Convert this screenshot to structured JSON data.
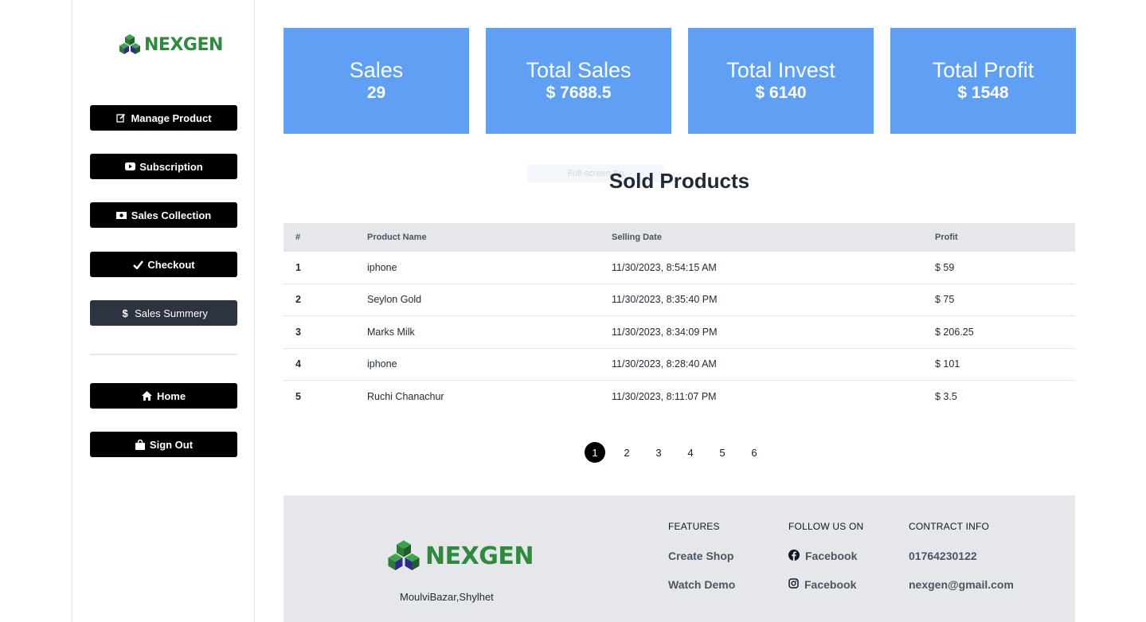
{
  "brand": {
    "name": "NEXGEN"
  },
  "sidebar": {
    "items": [
      {
        "label": "Manage Product",
        "icon": "edit-icon"
      },
      {
        "label": "Subscription",
        "icon": "youtube-icon"
      },
      {
        "label": "Sales Collection",
        "icon": "money-icon"
      },
      {
        "label": "Checkout",
        "icon": "check-icon"
      },
      {
        "label": "Sales Summery",
        "icon": "dollar-icon",
        "active": true
      }
    ],
    "bottom_items": [
      {
        "label": "Home",
        "icon": "home-icon"
      },
      {
        "label": "Sign Out",
        "icon": "bag-icon"
      }
    ]
  },
  "stats": [
    {
      "label": "Sales",
      "value": "29"
    },
    {
      "label": "Total Sales",
      "value": "$ 7688.5"
    },
    {
      "label": "Total Invest",
      "value": "$ 6140"
    },
    {
      "label": "Total Profit",
      "value": "$ 1548"
    }
  ],
  "fullscreen_hint": "Full-screen Sn",
  "section_title": "Sold Products",
  "table": {
    "headers": [
      "#",
      "Product Name",
      "Selling Date",
      "Profit"
    ],
    "rows": [
      [
        "1",
        "iphone",
        "11/30/2023, 8:54:15 AM",
        "$ 59"
      ],
      [
        "2",
        "Seylon Gold",
        "11/30/2023, 8:35:40 PM",
        "$ 75"
      ],
      [
        "3",
        "Marks Milk",
        "11/30/2023, 8:34:09 PM",
        "$ 206.25"
      ],
      [
        "4",
        "iphone",
        "11/30/2023, 8:28:40 AM",
        "$ 101"
      ],
      [
        "5",
        "Ruchi Chanachur",
        "11/30/2023, 8:11:07 PM",
        "$ 3.5"
      ]
    ]
  },
  "pagination": {
    "pages": [
      "1",
      "2",
      "3",
      "4",
      "5",
      "6"
    ],
    "current": "1"
  },
  "footer": {
    "address": "MoulviBazar,Shylhet",
    "features": {
      "title": "FEATURES",
      "links": [
        "Create Shop",
        "Watch Demo"
      ]
    },
    "follow": {
      "title": "FOLLOW US ON",
      "links": [
        {
          "label": "Facebook",
          "icon": "facebook-icon"
        },
        {
          "label": "Facebook",
          "icon": "instagram-icon"
        }
      ]
    },
    "contact": {
      "title": "CONTRACT INFO",
      "phone": "01764230122",
      "email": "nexgen@gmail.com"
    }
  },
  "colors": {
    "card": "#60a0f4",
    "brand_green": "#2e8b3e",
    "sidebar_btn": "#000000",
    "sidebar_active": "#2d3340",
    "footer_bg": "#e5e7eb"
  }
}
